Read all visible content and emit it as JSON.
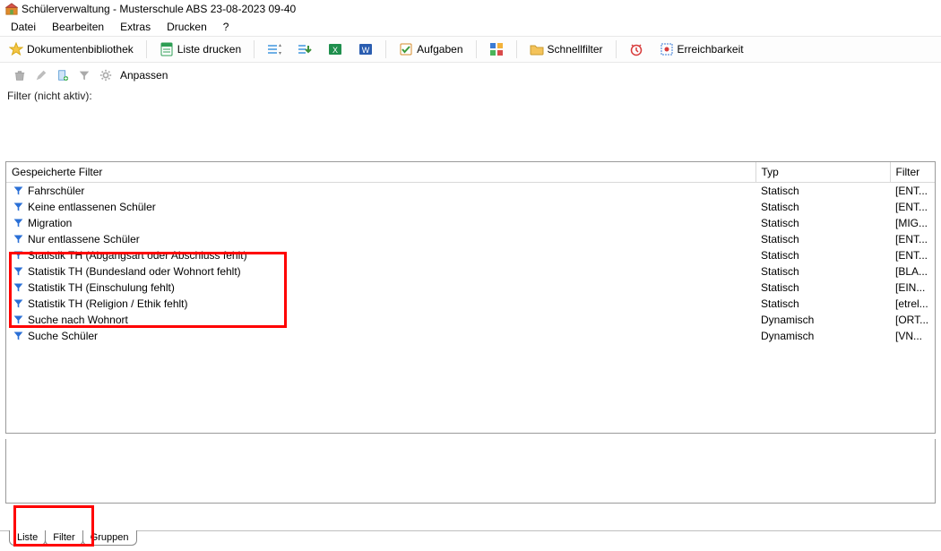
{
  "window": {
    "title": "Schülerverwaltung - Musterschule ABS 23-08-2023 09-40"
  },
  "menubar": {
    "items": [
      "Datei",
      "Bearbeiten",
      "Extras",
      "Drucken",
      "?"
    ]
  },
  "toolbar": {
    "doc_lib": "Dokumentenbibliothek",
    "print_list": "Liste drucken",
    "tasks": "Aufgaben",
    "quickfilter": "Schnellfilter",
    "reachability": "Erreichbarkeit"
  },
  "secondary": {
    "customize": "Anpassen"
  },
  "filter_status": "Filter (nicht aktiv):",
  "table": {
    "headers": {
      "name": "Gespeicherte Filter",
      "type": "Typ",
      "filter": "Filter"
    },
    "rows": [
      {
        "name": "Fahrschüler",
        "type": "Statisch",
        "filter": "[ENT..."
      },
      {
        "name": "Keine entlassenen Schüler",
        "type": "Statisch",
        "filter": "[ENT..."
      },
      {
        "name": "Migration",
        "type": "Statisch",
        "filter": "[MIG..."
      },
      {
        "name": "Nur entlassene Schüler",
        "type": "Statisch",
        "filter": "[ENT..."
      },
      {
        "name": "Statistik TH (Abgangsart oder Abschluss fehlt)",
        "type": "Statisch",
        "filter": "[ENT..."
      },
      {
        "name": "Statistik TH (Bundesland oder Wohnort fehlt)",
        "type": "Statisch",
        "filter": "[BLA..."
      },
      {
        "name": "Statistik TH (Einschulung fehlt)",
        "type": "Statisch",
        "filter": "[EIN..."
      },
      {
        "name": "Statistik TH (Religion / Ethik fehlt)",
        "type": "Statisch",
        "filter": "[etrel..."
      },
      {
        "name": "Suche nach Wohnort",
        "type": "Dynamisch",
        "filter": "[ORT..."
      },
      {
        "name": "Suche Schüler",
        "type": "Dynamisch",
        "filter": "[VN..."
      }
    ]
  },
  "tabs": {
    "list": "Liste",
    "filter": "Filter",
    "groups": "Gruppen"
  }
}
